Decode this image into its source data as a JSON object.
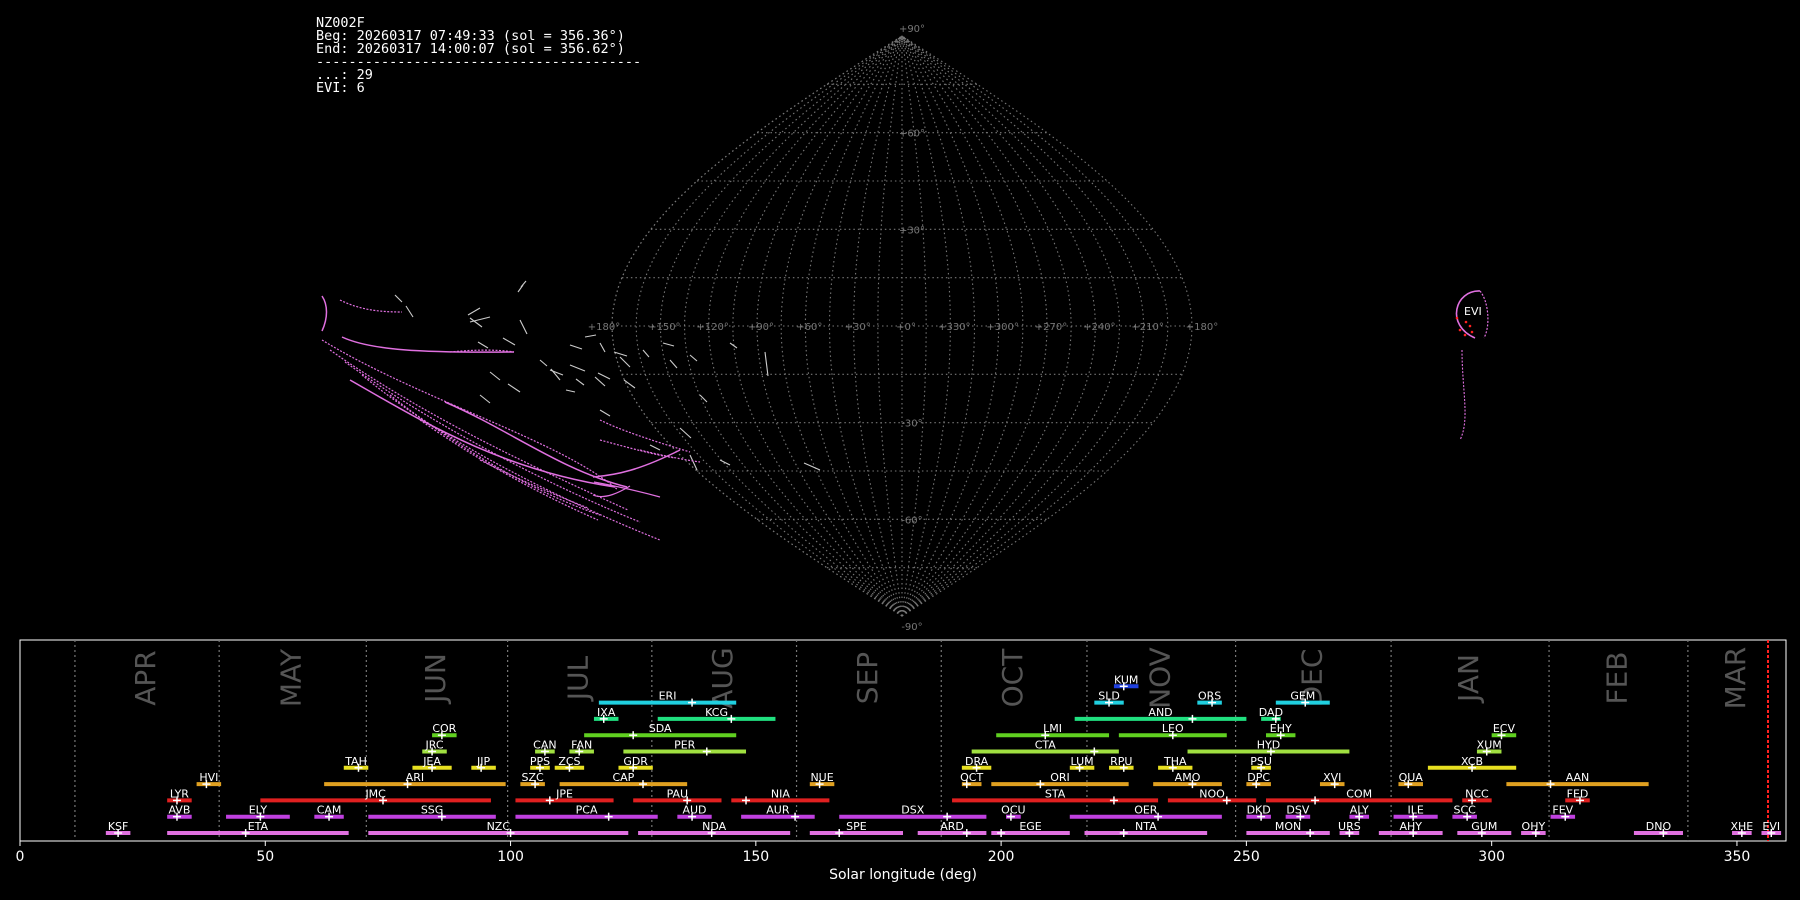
{
  "info": {
    "station": "NZ002F",
    "begin": "Beg: 20260317 07:49:33 (sol = 356.36°)",
    "end": "End: 20260317 14:00:07 (sol = 356.62°)",
    "separator": "----------------------------------------",
    "count_all": "...: 29",
    "count_evi": "EVI: 6"
  },
  "colors": {
    "background": "#000000",
    "grid": "#777777",
    "month_text": "#555555",
    "current_line": "#ff2020",
    "meteor_sporadic": "#cccccc",
    "meteor_shower": "#e070e0"
  },
  "sky_map": {
    "projection": "sinusoidal",
    "lon_labels": [
      "+180°",
      "+150°",
      "+120°",
      "+90°",
      "+60°",
      "+30°",
      "+0°",
      "+330°",
      "+300°",
      "+270°",
      "+240°",
      "+210°",
      "+180°"
    ],
    "lat_labels": [
      "+90°",
      "+60°",
      "+30°",
      "-30°",
      "-60°",
      "-90°"
    ],
    "radiant_label": "EVI"
  },
  "chart_data": {
    "type": "gantt",
    "xlabel": "Solar longitude (deg)",
    "xlim": [
      0,
      360
    ],
    "xticks": [
      0,
      50,
      100,
      150,
      200,
      250,
      300,
      350
    ],
    "current_sol": 360,
    "months": [
      {
        "name": "APR",
        "start": 11.2
      },
      {
        "name": "MAY",
        "start": 40.6
      },
      {
        "name": "JUN",
        "start": 70.6
      },
      {
        "name": "JUL",
        "start": 99.4
      },
      {
        "name": "AUG",
        "start": 128.8
      },
      {
        "name": "SEP",
        "start": 158.3
      },
      {
        "name": "OCT",
        "start": 187.8
      },
      {
        "name": "NOV",
        "start": 217.5
      },
      {
        "name": "DEC",
        "start": 247.8
      },
      {
        "name": "JAN",
        "start": 279.5
      },
      {
        "name": "FEB",
        "start": 311.7
      },
      {
        "name": "MAR",
        "start": 340.0
      }
    ],
    "rows": [
      {
        "row": 0,
        "color": "#e070e0",
        "showers": [
          {
            "code": "KSF",
            "start": 17.5,
            "end": 22.5,
            "peak": 20
          },
          {
            "code": "ETA",
            "start": 30,
            "end": 67,
            "peak": 46
          },
          {
            "code": "NZC",
            "start": 71,
            "end": 124,
            "peak": 100
          },
          {
            "code": "NDA",
            "start": 126,
            "end": 157,
            "peak": 141
          },
          {
            "code": "SPE",
            "start": 161,
            "end": 180,
            "peak": 167
          },
          {
            "code": "ARD",
            "start": 183,
            "end": 197,
            "peak": 193
          },
          {
            "code": "EGE",
            "start": 198,
            "end": 214,
            "peak": 200
          },
          {
            "code": "NTA",
            "start": 217,
            "end": 242,
            "peak": 225
          },
          {
            "code": "MON",
            "start": 250,
            "end": 267,
            "peak": 263
          },
          {
            "code": "URS",
            "start": 269,
            "end": 273,
            "peak": 271
          },
          {
            "code": "AHY",
            "start": 277,
            "end": 290,
            "peak": 284
          },
          {
            "code": "GUM",
            "start": 293,
            "end": 304,
            "peak": 298
          },
          {
            "code": "OHY",
            "start": 306,
            "end": 311,
            "peak": 309
          },
          {
            "code": "DNO",
            "start": 329,
            "end": 339,
            "peak": 335
          },
          {
            "code": "XHE",
            "start": 349,
            "end": 353,
            "peak": 351
          },
          {
            "code": "EVI",
            "start": 355,
            "end": 359,
            "peak": 357
          }
        ]
      },
      {
        "row": 1,
        "color": "#c040e0",
        "showers": [
          {
            "code": "AVB",
            "start": 30,
            "end": 35,
            "peak": 32
          },
          {
            "code": "ELY",
            "start": 42,
            "end": 55,
            "peak": 49
          },
          {
            "code": "CAM",
            "start": 60,
            "end": 66,
            "peak": 63
          },
          {
            "code": "SSG",
            "start": 71,
            "end": 97,
            "peak": 86
          },
          {
            "code": "PCA",
            "start": 101,
            "end": 130,
            "peak": 120
          },
          {
            "code": "AUD",
            "start": 134,
            "end": 141,
            "peak": 137
          },
          {
            "code": "AUR",
            "start": 147,
            "end": 162,
            "peak": 158
          },
          {
            "code": "DSX",
            "start": 167,
            "end": 197,
            "peak": 189
          },
          {
            "code": "OCU",
            "start": 201,
            "end": 204,
            "peak": 202
          },
          {
            "code": "OER",
            "start": 214,
            "end": 245,
            "peak": 232
          },
          {
            "code": "DKD",
            "start": 250,
            "end": 255,
            "peak": 253
          },
          {
            "code": "DSV",
            "start": 258,
            "end": 263,
            "peak": 261
          },
          {
            "code": "ALY",
            "start": 271,
            "end": 275,
            "peak": 273
          },
          {
            "code": "ILE",
            "start": 280,
            "end": 289,
            "peak": 284
          },
          {
            "code": "SCC",
            "start": 292,
            "end": 297,
            "peak": 295
          },
          {
            "code": "FEV",
            "start": 312,
            "end": 317,
            "peak": 315
          }
        ]
      },
      {
        "row": 2,
        "color": "#e02020",
        "showers": [
          {
            "code": "LYR",
            "start": 30,
            "end": 35,
            "peak": 32
          },
          {
            "code": "JMC",
            "start": 49,
            "end": 96,
            "peak": 74
          },
          {
            "code": "JPE",
            "start": 101,
            "end": 121,
            "peak": 108
          },
          {
            "code": "PAU",
            "start": 125,
            "end": 143,
            "peak": 136
          },
          {
            "code": "NIA",
            "start": 145,
            "end": 165,
            "peak": 148
          },
          {
            "code": "STA",
            "start": 190,
            "end": 232,
            "peak": 223
          },
          {
            "code": "NOO",
            "start": 234,
            "end": 252,
            "peak": 246
          },
          {
            "code": "COM",
            "start": 254,
            "end": 292,
            "peak": 264
          },
          {
            "code": "NCC",
            "start": 294,
            "end": 300,
            "peak": 296
          },
          {
            "code": "FED",
            "start": 315,
            "end": 320,
            "peak": 318
          }
        ]
      },
      {
        "row": 3,
        "color": "#e0a020",
        "showers": [
          {
            "code": "HVI",
            "start": 36,
            "end": 41,
            "peak": 38
          },
          {
            "code": "ARI",
            "start": 62,
            "end": 99,
            "peak": 79
          },
          {
            "code": "SZC",
            "start": 102,
            "end": 107,
            "peak": 105
          },
          {
            "code": "CAP",
            "start": 110,
            "end": 136,
            "peak": 127
          },
          {
            "code": "NUE",
            "start": 161,
            "end": 166,
            "peak": 163
          },
          {
            "code": "OCT",
            "start": 192,
            "end": 196,
            "peak": 193
          },
          {
            "code": "ORI",
            "start": 198,
            "end": 226,
            "peak": 208
          },
          {
            "code": "AMO",
            "start": 231,
            "end": 245,
            "peak": 239
          },
          {
            "code": "DPC",
            "start": 250,
            "end": 255,
            "peak": 252
          },
          {
            "code": "XVI",
            "start": 265,
            "end": 270,
            "peak": 268
          },
          {
            "code": "QUA",
            "start": 281,
            "end": 286,
            "peak": 283
          },
          {
            "code": "AAN",
            "start": 303,
            "end": 332,
            "peak": 312
          }
        ]
      },
      {
        "row": 4,
        "color": "#e8e020",
        "showers": [
          {
            "code": "TAH",
            "start": 66,
            "end": 71,
            "peak": 69
          },
          {
            "code": "JEA",
            "start": 80,
            "end": 88,
            "peak": 84
          },
          {
            "code": "JIP",
            "start": 92,
            "end": 97,
            "peak": 94
          },
          {
            "code": "PPS",
            "start": 104,
            "end": 108,
            "peak": 106
          },
          {
            "code": "ZCS",
            "start": 109,
            "end": 115,
            "peak": 112
          },
          {
            "code": "GDR",
            "start": 122,
            "end": 129,
            "peak": 125
          },
          {
            "code": "DRA",
            "start": 192,
            "end": 198,
            "peak": 195
          },
          {
            "code": "LUM",
            "start": 214,
            "end": 219,
            "peak": 216
          },
          {
            "code": "RPU",
            "start": 222,
            "end": 227,
            "peak": 225
          },
          {
            "code": "THA",
            "start": 232,
            "end": 239,
            "peak": 235
          },
          {
            "code": "PSU",
            "start": 251,
            "end": 255,
            "peak": 253
          },
          {
            "code": "XCB",
            "start": 287,
            "end": 305,
            "peak": 296
          }
        ]
      },
      {
        "row": 5,
        "color": "#a0e040",
        "showers": [
          {
            "code": "JRC",
            "start": 82,
            "end": 87,
            "peak": 84
          },
          {
            "code": "CAN",
            "start": 105,
            "end": 109,
            "peak": 107
          },
          {
            "code": "FAN",
            "start": 112,
            "end": 117,
            "peak": 114
          },
          {
            "code": "PER",
            "start": 123,
            "end": 148,
            "peak": 140
          },
          {
            "code": "CTA",
            "start": 194,
            "end": 224,
            "peak": 219
          },
          {
            "code": "HYD",
            "start": 238,
            "end": 271,
            "peak": 255
          },
          {
            "code": "XUM",
            "start": 297,
            "end": 302,
            "peak": 299
          }
        ]
      },
      {
        "row": 6,
        "color": "#60d020",
        "showers": [
          {
            "code": "COR",
            "start": 84,
            "end": 89,
            "peak": 86
          },
          {
            "code": "SDA",
            "start": 115,
            "end": 146,
            "peak": 125
          },
          {
            "code": "LMI",
            "start": 199,
            "end": 222,
            "peak": 209
          },
          {
            "code": "LEO",
            "start": 224,
            "end": 246,
            "peak": 235
          },
          {
            "code": "EHY",
            "start": 254,
            "end": 260,
            "peak": 257
          },
          {
            "code": "ECV",
            "start": 300,
            "end": 305,
            "peak": 302
          }
        ]
      },
      {
        "row": 7,
        "color": "#20e080",
        "showers": [
          {
            "code": "IXA",
            "start": 117,
            "end": 122,
            "peak": 119
          },
          {
            "code": "KCG",
            "start": 130,
            "end": 154,
            "peak": 145
          },
          {
            "code": "AND",
            "start": 215,
            "end": 250,
            "peak": 239
          },
          {
            "code": "DAD",
            "start": 253,
            "end": 257,
            "peak": 256
          }
        ]
      },
      {
        "row": 8,
        "color": "#20d0e0",
        "showers": [
          {
            "code": "ERI",
            "start": 118,
            "end": 146,
            "peak": 137
          },
          {
            "code": "SLD",
            "start": 219,
            "end": 225,
            "peak": 222
          },
          {
            "code": "ORS",
            "start": 240,
            "end": 245,
            "peak": 243
          },
          {
            "code": "GEM",
            "start": 256,
            "end": 267,
            "peak": 262
          }
        ]
      },
      {
        "row": 9,
        "color": "#2040e0",
        "showers": [
          {
            "code": "KUM",
            "start": 223,
            "end": 228,
            "peak": 225
          }
        ]
      }
    ]
  }
}
